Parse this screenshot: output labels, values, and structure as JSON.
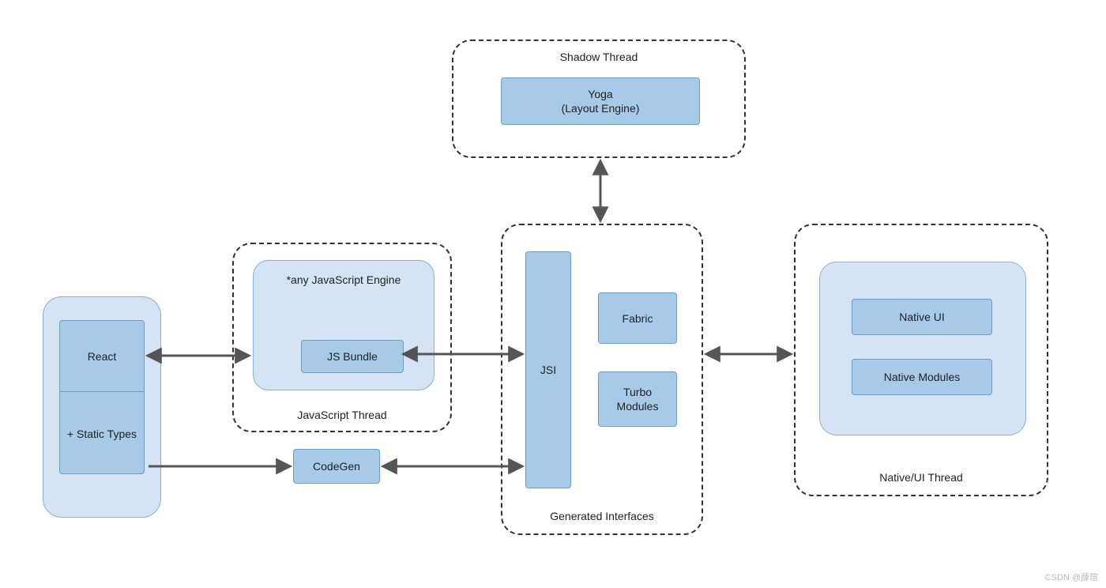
{
  "containers": {
    "shadow_thread": {
      "title": "Shadow Thread"
    },
    "js_thread": {
      "title": "JavaScript Thread",
      "engine_label": "*any JavaScript Engine"
    },
    "generated_interfaces": {
      "title": "Generated Interfaces"
    },
    "native_thread": {
      "title": "Native/UI Thread"
    }
  },
  "boxes": {
    "yoga_line1": "Yoga",
    "yoga_line2": "(Layout Engine)",
    "react": "React",
    "static_types": "+ Static Types",
    "js_bundle": "JS Bundle",
    "codegen": "CodeGen",
    "jsi": "JSI",
    "fabric": "Fabric",
    "turbo_modules": "Turbo Modules",
    "native_ui": "Native UI",
    "native_modules": "Native Modules"
  },
  "colors": {
    "box_fill": "#a6cae8",
    "box_stroke": "#6b9dc6",
    "container_fill": "#d4e4f4",
    "dashed_stroke": "#333333",
    "arrow": "#555555"
  },
  "watermark": "CSDN @薛瑄",
  "arrows": [
    {
      "from": "react-stack",
      "to": "js-engine",
      "dir": "both"
    },
    {
      "from": "react-stack",
      "to": "codegen",
      "dir": "single"
    },
    {
      "from": "js-bundle",
      "to": "jsi",
      "dir": "both"
    },
    {
      "from": "codegen",
      "to": "jsi",
      "dir": "both"
    },
    {
      "from": "generated-interfaces",
      "to": "shadow-thread",
      "dir": "both"
    },
    {
      "from": "generated-interfaces",
      "to": "native-thread",
      "dir": "both"
    }
  ]
}
